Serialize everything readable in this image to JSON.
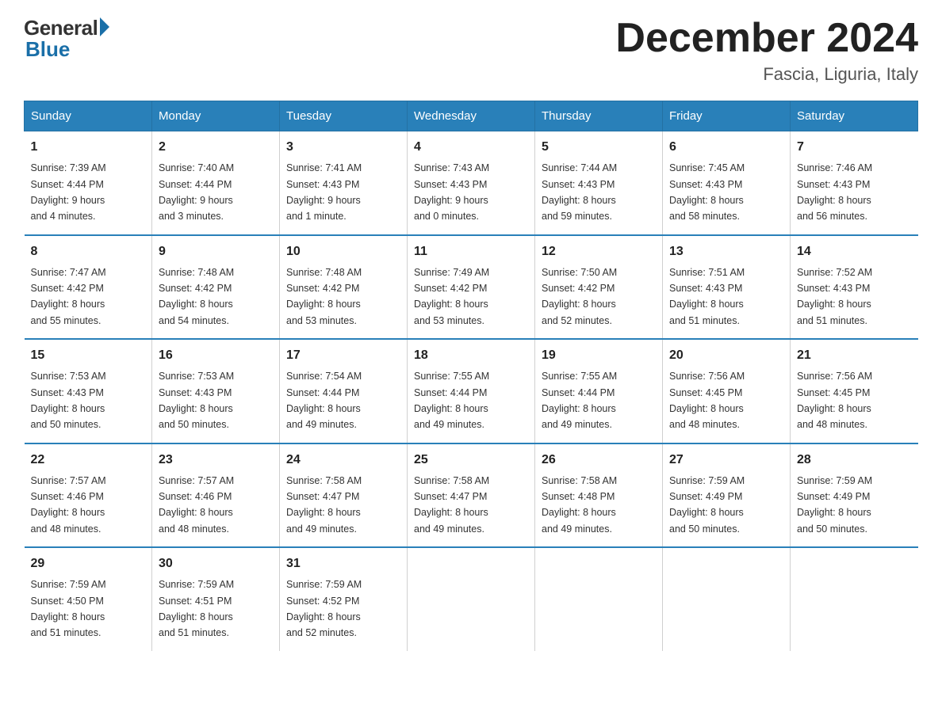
{
  "logo": {
    "general": "General",
    "blue": "Blue"
  },
  "header": {
    "month": "December 2024",
    "location": "Fascia, Liguria, Italy"
  },
  "days_of_week": [
    "Sunday",
    "Monday",
    "Tuesday",
    "Wednesday",
    "Thursday",
    "Friday",
    "Saturday"
  ],
  "weeks": [
    [
      {
        "day": "1",
        "sunrise": "7:39 AM",
        "sunset": "4:44 PM",
        "daylight": "9 hours and 4 minutes."
      },
      {
        "day": "2",
        "sunrise": "7:40 AM",
        "sunset": "4:44 PM",
        "daylight": "9 hours and 3 minutes."
      },
      {
        "day": "3",
        "sunrise": "7:41 AM",
        "sunset": "4:43 PM",
        "daylight": "9 hours and 1 minute."
      },
      {
        "day": "4",
        "sunrise": "7:43 AM",
        "sunset": "4:43 PM",
        "daylight": "9 hours and 0 minutes."
      },
      {
        "day": "5",
        "sunrise": "7:44 AM",
        "sunset": "4:43 PM",
        "daylight": "8 hours and 59 minutes."
      },
      {
        "day": "6",
        "sunrise": "7:45 AM",
        "sunset": "4:43 PM",
        "daylight": "8 hours and 58 minutes."
      },
      {
        "day": "7",
        "sunrise": "7:46 AM",
        "sunset": "4:43 PM",
        "daylight": "8 hours and 56 minutes."
      }
    ],
    [
      {
        "day": "8",
        "sunrise": "7:47 AM",
        "sunset": "4:42 PM",
        "daylight": "8 hours and 55 minutes."
      },
      {
        "day": "9",
        "sunrise": "7:48 AM",
        "sunset": "4:42 PM",
        "daylight": "8 hours and 54 minutes."
      },
      {
        "day": "10",
        "sunrise": "7:48 AM",
        "sunset": "4:42 PM",
        "daylight": "8 hours and 53 minutes."
      },
      {
        "day": "11",
        "sunrise": "7:49 AM",
        "sunset": "4:42 PM",
        "daylight": "8 hours and 53 minutes."
      },
      {
        "day": "12",
        "sunrise": "7:50 AM",
        "sunset": "4:42 PM",
        "daylight": "8 hours and 52 minutes."
      },
      {
        "day": "13",
        "sunrise": "7:51 AM",
        "sunset": "4:43 PM",
        "daylight": "8 hours and 51 minutes."
      },
      {
        "day": "14",
        "sunrise": "7:52 AM",
        "sunset": "4:43 PM",
        "daylight": "8 hours and 51 minutes."
      }
    ],
    [
      {
        "day": "15",
        "sunrise": "7:53 AM",
        "sunset": "4:43 PM",
        "daylight": "8 hours and 50 minutes."
      },
      {
        "day": "16",
        "sunrise": "7:53 AM",
        "sunset": "4:43 PM",
        "daylight": "8 hours and 50 minutes."
      },
      {
        "day": "17",
        "sunrise": "7:54 AM",
        "sunset": "4:44 PM",
        "daylight": "8 hours and 49 minutes."
      },
      {
        "day": "18",
        "sunrise": "7:55 AM",
        "sunset": "4:44 PM",
        "daylight": "8 hours and 49 minutes."
      },
      {
        "day": "19",
        "sunrise": "7:55 AM",
        "sunset": "4:44 PM",
        "daylight": "8 hours and 49 minutes."
      },
      {
        "day": "20",
        "sunrise": "7:56 AM",
        "sunset": "4:45 PM",
        "daylight": "8 hours and 48 minutes."
      },
      {
        "day": "21",
        "sunrise": "7:56 AM",
        "sunset": "4:45 PM",
        "daylight": "8 hours and 48 minutes."
      }
    ],
    [
      {
        "day": "22",
        "sunrise": "7:57 AM",
        "sunset": "4:46 PM",
        "daylight": "8 hours and 48 minutes."
      },
      {
        "day": "23",
        "sunrise": "7:57 AM",
        "sunset": "4:46 PM",
        "daylight": "8 hours and 48 minutes."
      },
      {
        "day": "24",
        "sunrise": "7:58 AM",
        "sunset": "4:47 PM",
        "daylight": "8 hours and 49 minutes."
      },
      {
        "day": "25",
        "sunrise": "7:58 AM",
        "sunset": "4:47 PM",
        "daylight": "8 hours and 49 minutes."
      },
      {
        "day": "26",
        "sunrise": "7:58 AM",
        "sunset": "4:48 PM",
        "daylight": "8 hours and 49 minutes."
      },
      {
        "day": "27",
        "sunrise": "7:59 AM",
        "sunset": "4:49 PM",
        "daylight": "8 hours and 50 minutes."
      },
      {
        "day": "28",
        "sunrise": "7:59 AM",
        "sunset": "4:49 PM",
        "daylight": "8 hours and 50 minutes."
      }
    ],
    [
      {
        "day": "29",
        "sunrise": "7:59 AM",
        "sunset": "4:50 PM",
        "daylight": "8 hours and 51 minutes."
      },
      {
        "day": "30",
        "sunrise": "7:59 AM",
        "sunset": "4:51 PM",
        "daylight": "8 hours and 51 minutes."
      },
      {
        "day": "31",
        "sunrise": "7:59 AM",
        "sunset": "4:52 PM",
        "daylight": "8 hours and 52 minutes."
      },
      null,
      null,
      null,
      null
    ]
  ],
  "labels": {
    "sunrise": "Sunrise:",
    "sunset": "Sunset:",
    "daylight": "Daylight:"
  }
}
